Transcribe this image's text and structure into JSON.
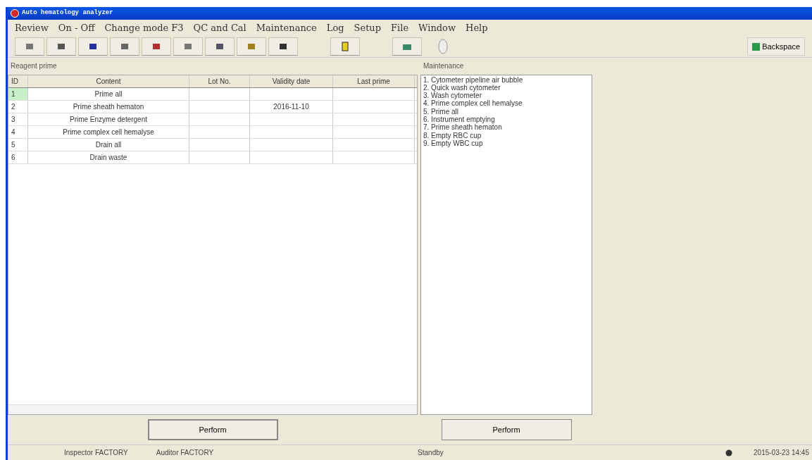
{
  "window": {
    "title": "Auto hematology analyzer"
  },
  "menu": [
    "Review",
    "On - Off",
    "Change mode F3",
    "QC and Cal",
    "Maintenance",
    "Log",
    "Setup",
    "File",
    "Window",
    "Help"
  ],
  "toolbar": {
    "backspace": "Backspace"
  },
  "reagent_prime": {
    "title": "Reagent prime",
    "columns": [
      "ID",
      "Content",
      "Lot No.",
      "Validity date",
      "Last prime"
    ],
    "rows": [
      {
        "id": "1",
        "content": "Prime all",
        "lot": "",
        "validity": "",
        "last": "",
        "selected": true
      },
      {
        "id": "2",
        "content": "Prime sheath hematon",
        "lot": "",
        "validity": "2016-11-10",
        "last": "",
        "selected": false
      },
      {
        "id": "3",
        "content": "Prime Enzyme detergent",
        "lot": "",
        "validity": "",
        "last": "",
        "selected": false
      },
      {
        "id": "4",
        "content": "Prime complex cell hemalyse",
        "lot": "",
        "validity": "",
        "last": "",
        "selected": false
      },
      {
        "id": "5",
        "content": "Drain all",
        "lot": "",
        "validity": "",
        "last": "",
        "selected": false
      },
      {
        "id": "6",
        "content": "Drain waste",
        "lot": "",
        "validity": "",
        "last": "",
        "selected": false
      }
    ],
    "button": "Perform"
  },
  "maintenance": {
    "title": "Maintenance",
    "items": [
      "1. Cytometer pipeline air bubble",
      "2. Quick wash cytometer",
      "3. Wash cytometer",
      "4. Prime complex cell hemalyse",
      "5. Prime all",
      "6. Instrument emptying",
      "7. Prime sheath hematon",
      "8. Empty RBC cup",
      "9. Empty WBC cup"
    ],
    "button": "Perform"
  },
  "status_bar": {
    "inspector": "Inspector  FACTORY",
    "auditor": "Auditor  FACTORY",
    "state": "Standby",
    "datetime": "2015-03-23 14:45"
  }
}
